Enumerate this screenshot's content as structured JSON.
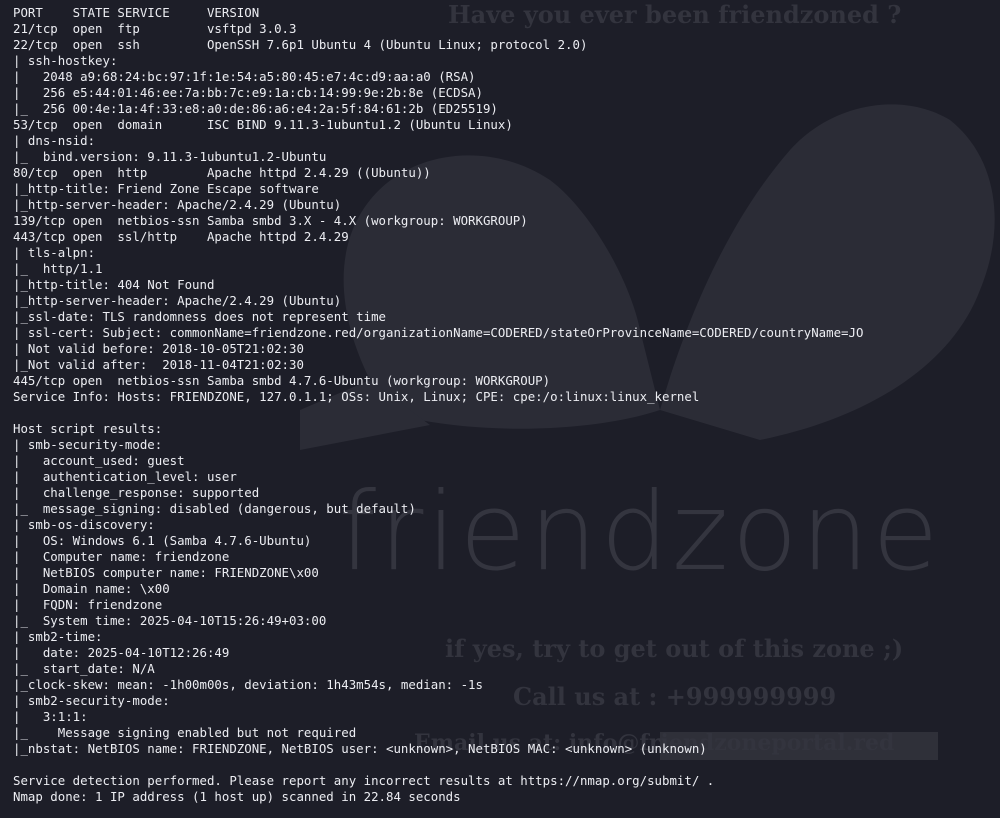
{
  "background": {
    "title": "Have you ever been friendzoned ?",
    "logo": "friendzone",
    "tagline": "if yes, try to get out of this zone ;)",
    "call": "Call us at : +999999999",
    "email": "Email us at: info@friendzoneportal.red"
  },
  "terminal": {
    "lines": [
      "PORT    STATE SERVICE     VERSION",
      "21/tcp  open  ftp         vsftpd 3.0.3",
      "22/tcp  open  ssh         OpenSSH 7.6p1 Ubuntu 4 (Ubuntu Linux; protocol 2.0)",
      "| ssh-hostkey: ",
      "|   2048 a9:68:24:bc:97:1f:1e:54:a5:80:45:e7:4c:d9:aa:a0 (RSA)",
      "|   256 e5:44:01:46:ee:7a:bb:7c:e9:1a:cb:14:99:9e:2b:8e (ECDSA)",
      "|_  256 00:4e:1a:4f:33:e8:a0:de:86:a6:e4:2a:5f:84:61:2b (ED25519)",
      "53/tcp  open  domain      ISC BIND 9.11.3-1ubuntu1.2 (Ubuntu Linux)",
      "| dns-nsid: ",
      "|_  bind.version: 9.11.3-1ubuntu1.2-Ubuntu",
      "80/tcp  open  http        Apache httpd 2.4.29 ((Ubuntu))",
      "|_http-title: Friend Zone Escape software",
      "|_http-server-header: Apache/2.4.29 (Ubuntu)",
      "139/tcp open  netbios-ssn Samba smbd 3.X - 4.X (workgroup: WORKGROUP)",
      "443/tcp open  ssl/http    Apache httpd 2.4.29",
      "| tls-alpn: ",
      "|_  http/1.1",
      "|_http-title: 404 Not Found",
      "|_http-server-header: Apache/2.4.29 (Ubuntu)",
      "|_ssl-date: TLS randomness does not represent time",
      "| ssl-cert: Subject: commonName=friendzone.red/organizationName=CODERED/stateOrProvinceName=CODERED/countryName=JO",
      "| Not valid before: 2018-10-05T21:02:30",
      "|_Not valid after:  2018-11-04T21:02:30",
      "445/tcp open  netbios-ssn Samba smbd 4.7.6-Ubuntu (workgroup: WORKGROUP)",
      "Service Info: Hosts: FRIENDZONE, 127.0.1.1; OSs: Unix, Linux; CPE: cpe:/o:linux:linux_kernel",
      "",
      "Host script results:",
      "| smb-security-mode: ",
      "|   account_used: guest",
      "|   authentication_level: user",
      "|   challenge_response: supported",
      "|_  message_signing: disabled (dangerous, but default)",
      "| smb-os-discovery: ",
      "|   OS: Windows 6.1 (Samba 4.7.6-Ubuntu)",
      "|   Computer name: friendzone",
      "|   NetBIOS computer name: FRIENDZONE\\x00",
      "|   Domain name: \\x00",
      "|   FQDN: friendzone",
      "|_  System time: 2025-04-10T15:26:49+03:00",
      "| smb2-time: ",
      "|   date: 2025-04-10T12:26:49",
      "|_  start_date: N/A",
      "|_clock-skew: mean: -1h00m00s, deviation: 1h43m54s, median: -1s",
      "| smb2-security-mode: ",
      "|   3:1:1: ",
      "|_    Message signing enabled but not required",
      "|_nbstat: NetBIOS name: FRIENDZONE, NetBIOS user: <unknown>, NetBIOS MAC: <unknown> (unknown)",
      "",
      "Service detection performed. Please report any incorrect results at https://nmap.org/submit/ .",
      "Nmap done: 1 IP address (1 host up) scanned in 22.84 seconds"
    ]
  }
}
